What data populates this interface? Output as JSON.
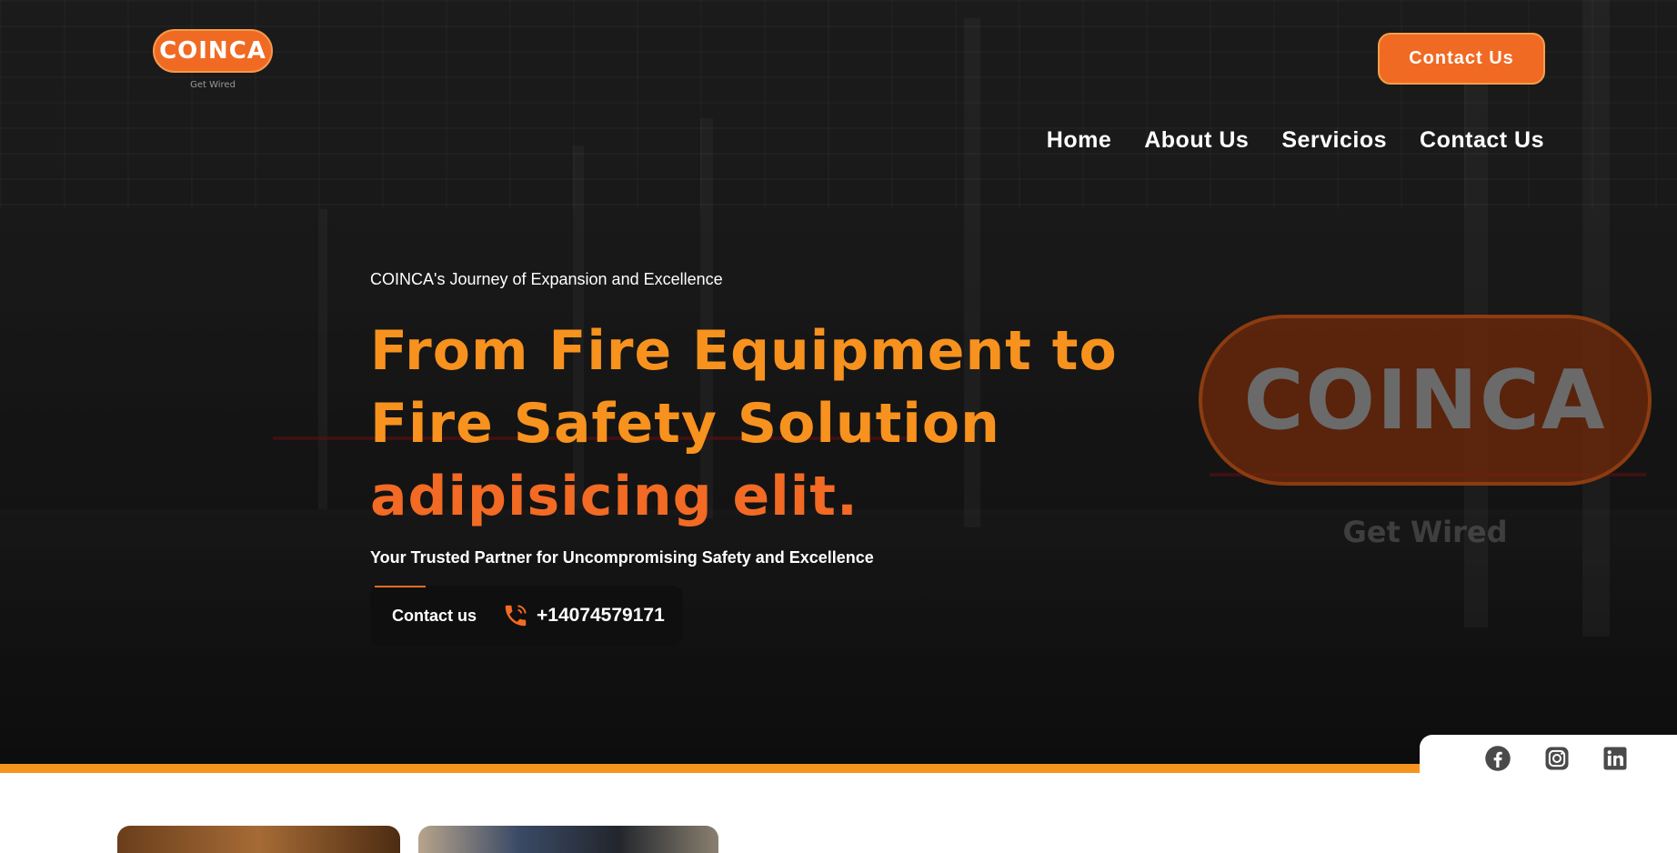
{
  "brand": {
    "logo_text": "COINCA",
    "tagline": "Get Wired",
    "accent": "#f26a23",
    "accent_alt": "#f7921e"
  },
  "header": {
    "contact_button": "Contact Us"
  },
  "nav": {
    "items": [
      "Home",
      "About Us",
      "Servicios",
      "Contact Us"
    ]
  },
  "hero": {
    "eyebrow": "COINCA's Journey of Expansion and Excellence",
    "headline_main": "From Fire Equipment to Fire Safety Solution ",
    "headline_accent": "adipisicing elit.",
    "subline": "Your Trusted Partner for Uncompromising Safety and Excellence",
    "cta_label": "Contact us",
    "phone_icon": "phone-icon",
    "phone": "+14074579171",
    "big_logo_text": "COINCA",
    "big_logo_tagline": "Get Wired"
  },
  "social": {
    "icons": [
      "facebook-icon",
      "instagram-icon",
      "linkedin-icon"
    ]
  }
}
